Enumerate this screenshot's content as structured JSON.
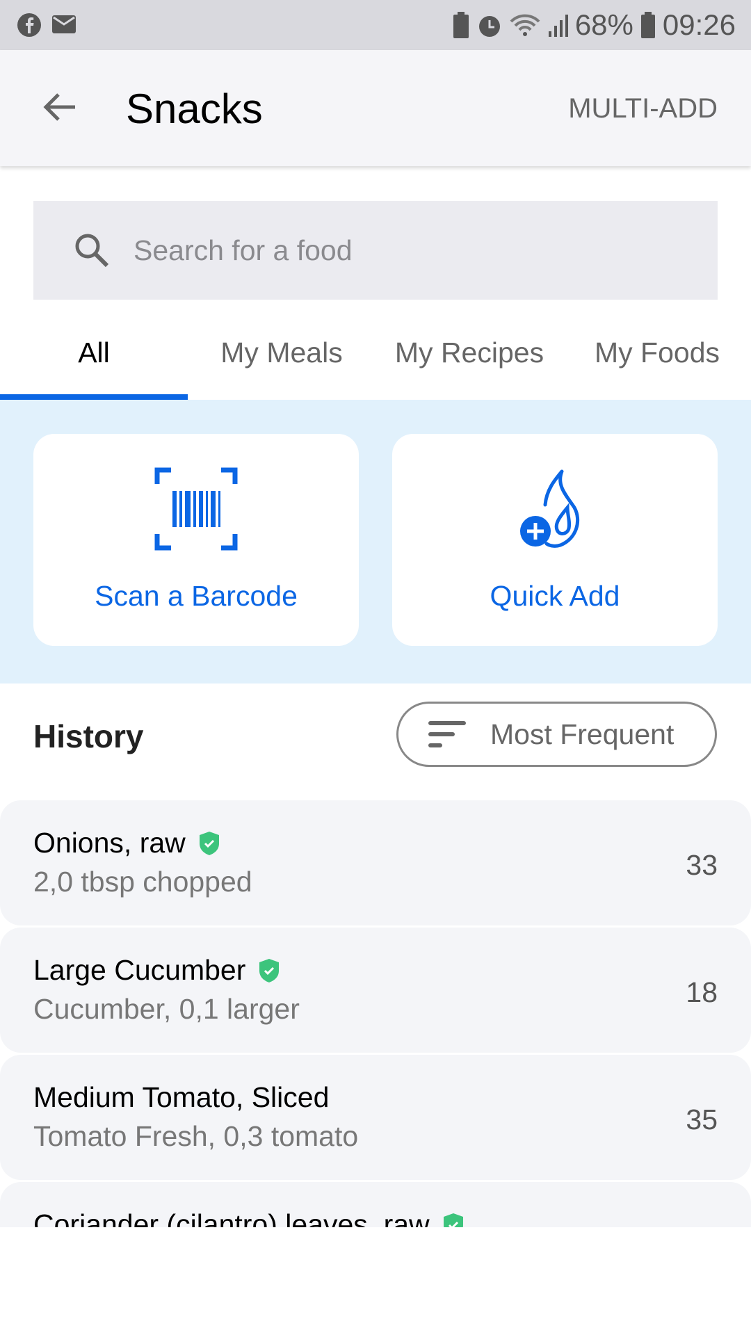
{
  "status_bar": {
    "icons_left": [
      "facebook-icon",
      "mail-icon"
    ],
    "icons_right": [
      "battery-saver-icon",
      "alarm-icon",
      "wifi-icon",
      "signal-icon"
    ],
    "battery": "68%",
    "time": "09:26"
  },
  "header": {
    "title": "Snacks",
    "action": "MULTI-ADD"
  },
  "search": {
    "placeholder": "Search for a food",
    "value": ""
  },
  "tabs": [
    {
      "label": "All",
      "active": true
    },
    {
      "label": "My Meals"
    },
    {
      "label": "My Recipes"
    },
    {
      "label": "My Foods"
    }
  ],
  "actions": [
    {
      "label": "Scan a Barcode",
      "icon": "barcode-scan-icon"
    },
    {
      "label": "Quick Add",
      "icon": "flame-plus-icon"
    }
  ],
  "history": {
    "title": "History",
    "sort_label": "Most Frequent"
  },
  "items": [
    {
      "name": "Onions, raw",
      "detail": "2,0 tbsp chopped",
      "calories": "33",
      "verified": true
    },
    {
      "name": "Large Cucumber",
      "detail": "Cucumber, 0,1 larger",
      "calories": "18",
      "verified": true
    },
    {
      "name": "Medium Tomato, Sliced",
      "detail": "Tomato Fresh, 0,3 tomato",
      "calories": "35",
      "verified": false
    },
    {
      "name": "Coriander (cilantro) leaves, raw",
      "detail": "",
      "calories": "",
      "verified": true
    }
  ],
  "colors": {
    "accent": "#0b66e4",
    "verified": "#3cc47c",
    "band": "#e1f1fc"
  }
}
